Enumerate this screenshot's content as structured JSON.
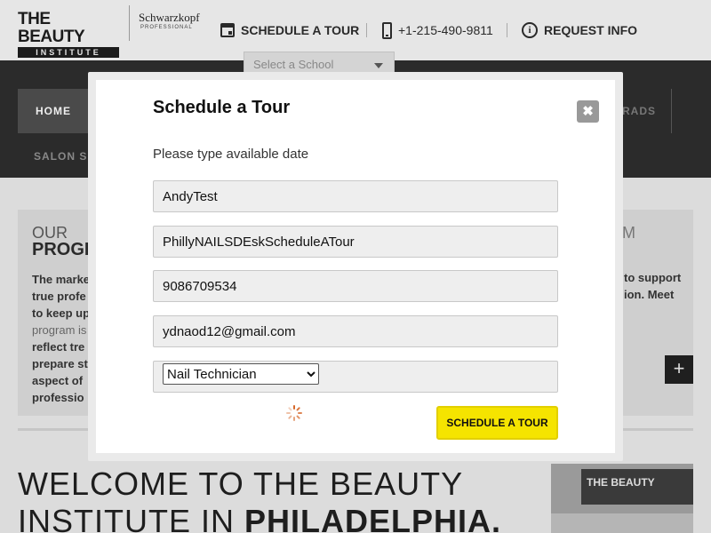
{
  "header": {
    "logo_line1": "THE BEAUTY",
    "logo_line2": "INSTITUTE",
    "partner_name": "Schwarzkopf",
    "partner_sub": "PROFESSIONAL",
    "schedule_tour_label": "SCHEDULE A TOUR",
    "phone": "+1-215-490-9811",
    "request_info_label": "REQUEST INFO",
    "school_select_placeholder": "Select a School",
    "icons": [
      "calendar-icon",
      "phone-icon",
      "info-icon",
      "chevron-down-icon"
    ]
  },
  "nav": {
    "home": "HOME",
    "grads": "RADS",
    "salon": "SALON SE"
  },
  "background": {
    "our": "OUR",
    "prog": "PROGR",
    "lines": [
      "The marke",
      "true profe",
      "to keep up",
      "program is",
      "reflect tre",
      "prepare st",
      "aspect of",
      "professio"
    ],
    "right_heading": "M",
    "right_lines": [
      "to support",
      "ion. Meet"
    ],
    "plus": "+",
    "welcome_line1": "WELCOME TO THE BEAUTY",
    "welcome_line2_plain": "INSTITUTE IN ",
    "welcome_line2_bold": "PHILADELPHIA.",
    "photo_sign": "THE BEAUTY"
  },
  "modal": {
    "title": "Schedule a Tour",
    "close_glyph": "✖",
    "subtitle": "Please type available date",
    "fields": {
      "name": "AndyTest",
      "lastname": "PhillyNAILSDEskScheduleATour",
      "phone": "9086709534",
      "email": "ydnaod12@gmail.com"
    },
    "program_options": [
      "Nail Technician"
    ],
    "program_selected": "Nail Technician",
    "submit_label": "SCHEDULE A TOUR",
    "accent_color": "#f5e400",
    "spinner_color": "#d6682a"
  }
}
